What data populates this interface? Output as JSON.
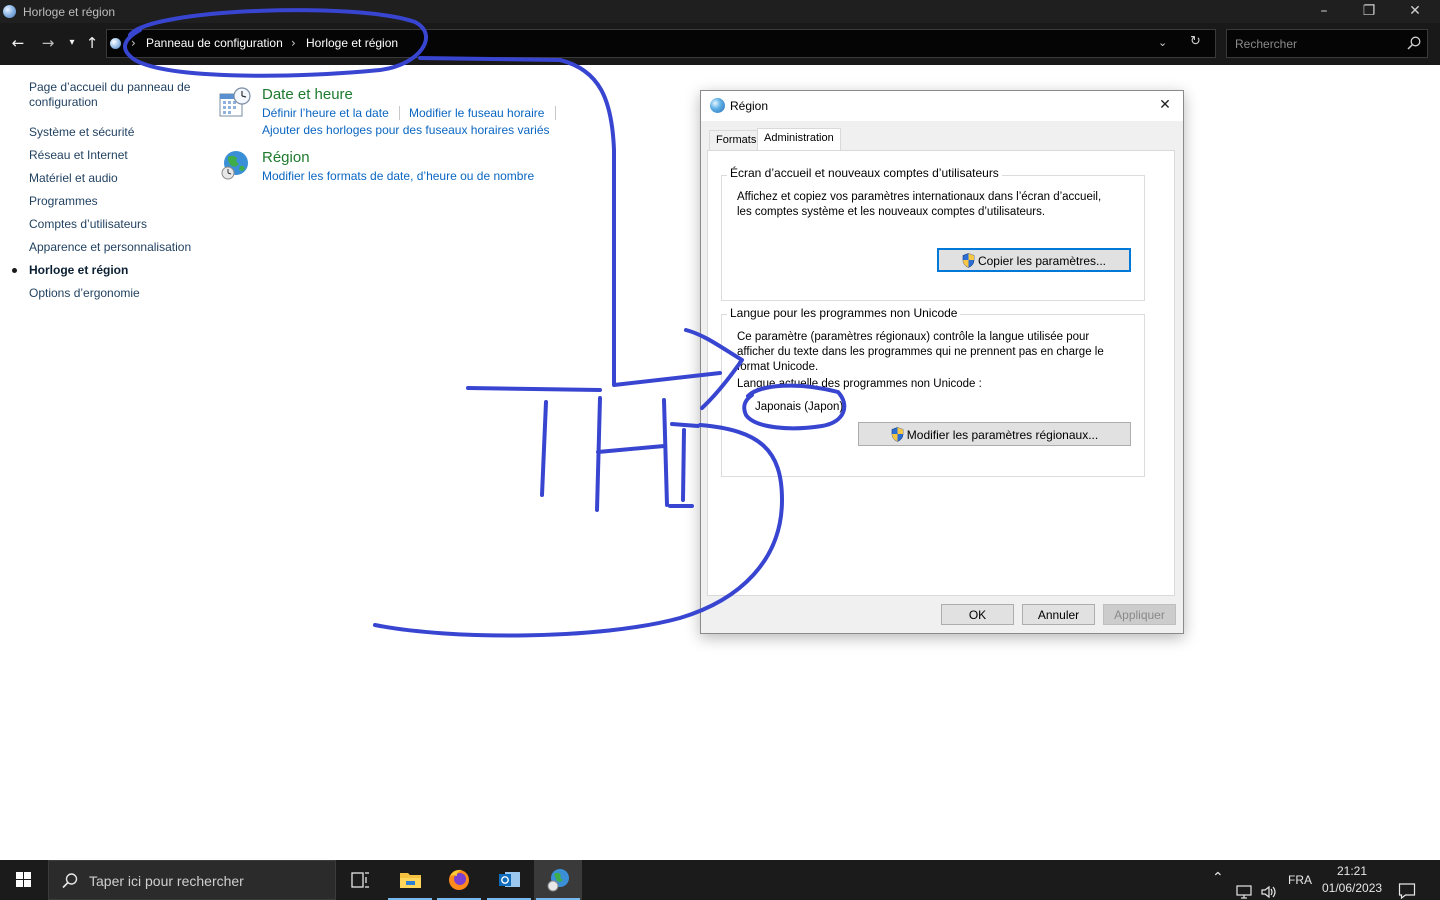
{
  "window": {
    "title": "Horloge et région",
    "controls": [
      "minimize-icon",
      "restore-icon",
      "close-icon"
    ]
  },
  "address_bar": {
    "breadcrumbs": [
      "Panneau de configuration",
      "Horloge et région"
    ],
    "search_placeholder": "Rechercher"
  },
  "sidebar": {
    "items": [
      {
        "label": "Page d’accueil du panneau de configuration",
        "active": false
      },
      {
        "label": "Système et sécurité",
        "active": false
      },
      {
        "label": "Réseau et Internet",
        "active": false
      },
      {
        "label": "Matériel et audio",
        "active": false
      },
      {
        "label": "Programmes",
        "active": false
      },
      {
        "label": "Comptes d’utilisateurs",
        "active": false
      },
      {
        "label": "Apparence et personnalisation",
        "active": false
      },
      {
        "label": "Horloge et région",
        "active": true
      },
      {
        "label": "Options d’ergonomie",
        "active": false
      }
    ]
  },
  "categories": {
    "date_time": {
      "title": "Date et heure",
      "links": [
        "Définir l’heure et la date",
        "Modifier le fuseau horaire",
        "Ajouter des horloges pour des fuseaux horaires variés"
      ]
    },
    "region": {
      "title": "Région",
      "links": [
        "Modifier les formats de date, d’heure ou de nombre"
      ]
    }
  },
  "dialog": {
    "title": "Région",
    "tabs": [
      {
        "label": "Formats",
        "selected": false
      },
      {
        "label": "Administration",
        "selected": true
      }
    ],
    "welcome_group": {
      "title": "Écran d’accueil et nouveaux comptes d’utilisateurs",
      "text_line1": "Affichez et copiez vos paramètres internationaux dans l’écran d’accueil,",
      "text_line2": "les comptes système et les nouveaux comptes d’utilisateurs.",
      "button": "Copier les paramètres..."
    },
    "unicode_group": {
      "title": "Langue pour les programmes non Unicode",
      "text_line1": "Ce paramètre (paramètres régionaux) contrôle la langue utilisée pour",
      "text_line2": "afficher du texte dans les programmes qui ne prennent pas en charge le",
      "text_line3": "format Unicode.",
      "current_label": "Langue actuelle des programmes non Unicode :",
      "current_value": "Japonais (Japon)",
      "button": "Modifier les paramètres régionaux..."
    },
    "buttons": {
      "ok": "OK",
      "cancel": "Annuler",
      "apply": "Appliquer"
    }
  },
  "annotation": {
    "color": "#3845d1",
    "handwritten_text": "THIS"
  },
  "taskbar": {
    "search_placeholder": "Taper ici pour rechercher",
    "language": "FRA",
    "time": "21:21",
    "date": "01/06/2023",
    "apps": [
      "task-view-icon",
      "file-explorer-icon",
      "firefox-icon",
      "outlook-icon",
      "control-panel-icon"
    ]
  },
  "colors": {
    "link_blue": "#0a66c2",
    "category_green": "#1e7a2e",
    "focus_blue": "#0078d7"
  }
}
